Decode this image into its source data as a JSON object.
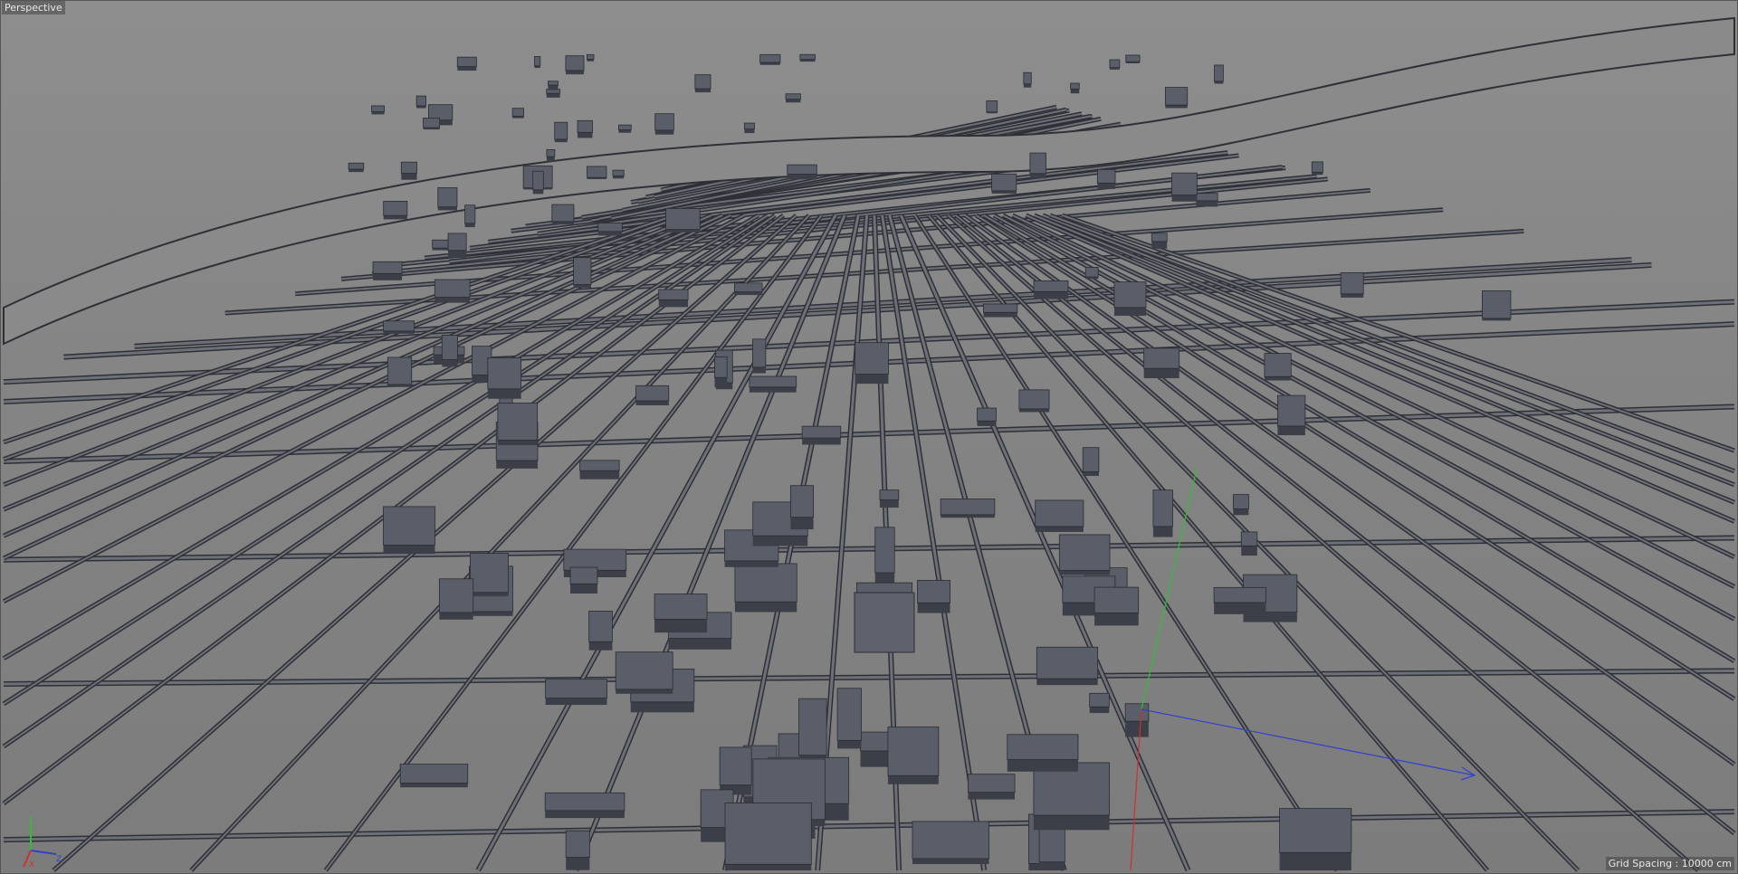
{
  "viewport": {
    "camera_label": "Perspective",
    "grid_spacing_label": "Grid Spacing : 10000 cm",
    "axis_labels": {
      "x": "X",
      "y": "Y",
      "z": "Z"
    }
  },
  "colors": {
    "background": "#868686",
    "road": "#2e3036",
    "road_fill": "#6d7078",
    "building_top": "#5a5e68",
    "building_side": "#3c3f47",
    "axis_x": "#d03030",
    "axis_y": "#30c030",
    "axis_z": "#3040d0"
  }
}
